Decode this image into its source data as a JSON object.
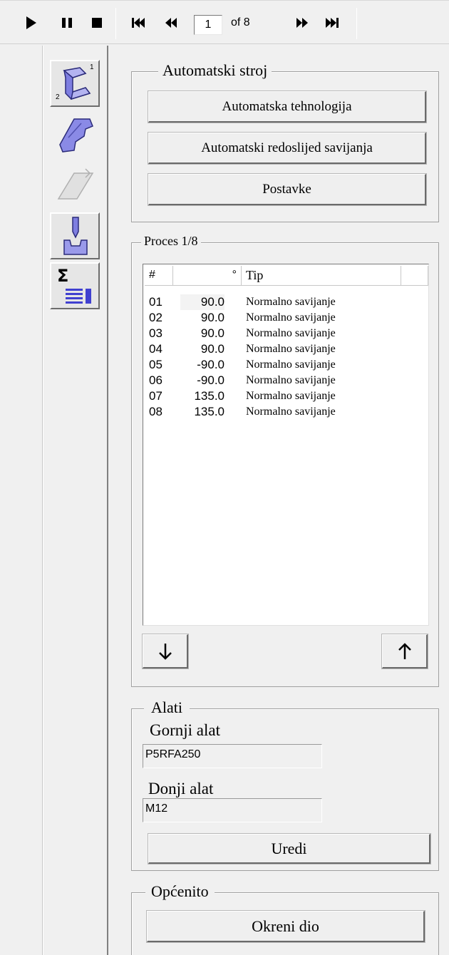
{
  "toolbar": {
    "play_icon": "play-icon",
    "pause_icon": "pause-icon",
    "stop_icon": "stop-icon",
    "first_icon": "skip-to-first-icon",
    "prev_icon": "fast-rewind-icon",
    "page_value": "1",
    "of_label": "of 8",
    "next_icon": "fast-forward-icon",
    "last_icon": "skip-to-last-icon"
  },
  "sidebar": {
    "items": [
      {
        "name": "bend-profile-icon",
        "label_top": "1",
        "label_bottom": "2"
      },
      {
        "name": "flat-part-icon"
      },
      {
        "name": "sheet-outline-icon"
      },
      {
        "name": "punch-die-icon"
      },
      {
        "name": "sum-list-icon",
        "label": "Σ"
      }
    ]
  },
  "automatic": {
    "title": "Automatski stroj",
    "buttons": [
      "Automatska tehnologija",
      "Automatski redoslijed savijanja",
      "Postavke"
    ]
  },
  "process": {
    "title": "Proces 1/8",
    "columns": [
      "#",
      "°",
      "Tip"
    ],
    "rows": [
      {
        "num": "01",
        "angle": "90.0",
        "tip": "Normalno savijanje"
      },
      {
        "num": "02",
        "angle": "90.0",
        "tip": "Normalno savijanje"
      },
      {
        "num": "03",
        "angle": "90.0",
        "tip": "Normalno savijanje"
      },
      {
        "num": "04",
        "angle": "90.0",
        "tip": "Normalno savijanje"
      },
      {
        "num": "05",
        "angle": "-90.0",
        "tip": "Normalno savijanje"
      },
      {
        "num": "06",
        "angle": "-90.0",
        "tip": "Normalno savijanje"
      },
      {
        "num": "07",
        "angle": "135.0",
        "tip": "Normalno savijanje"
      },
      {
        "num": "08",
        "angle": "135.0",
        "tip": "Normalno savijanje"
      }
    ],
    "down_icon": "arrow-down-icon",
    "up_icon": "arrow-up-icon"
  },
  "tools": {
    "title": "Alati",
    "upper_label": "Gornji alat",
    "upper_value": "P5RFA250",
    "lower_label": "Donji alat",
    "lower_value": "M12",
    "edit_button": "Uredi"
  },
  "general": {
    "title": "Općenito",
    "flip_button": "Okreni dio"
  }
}
